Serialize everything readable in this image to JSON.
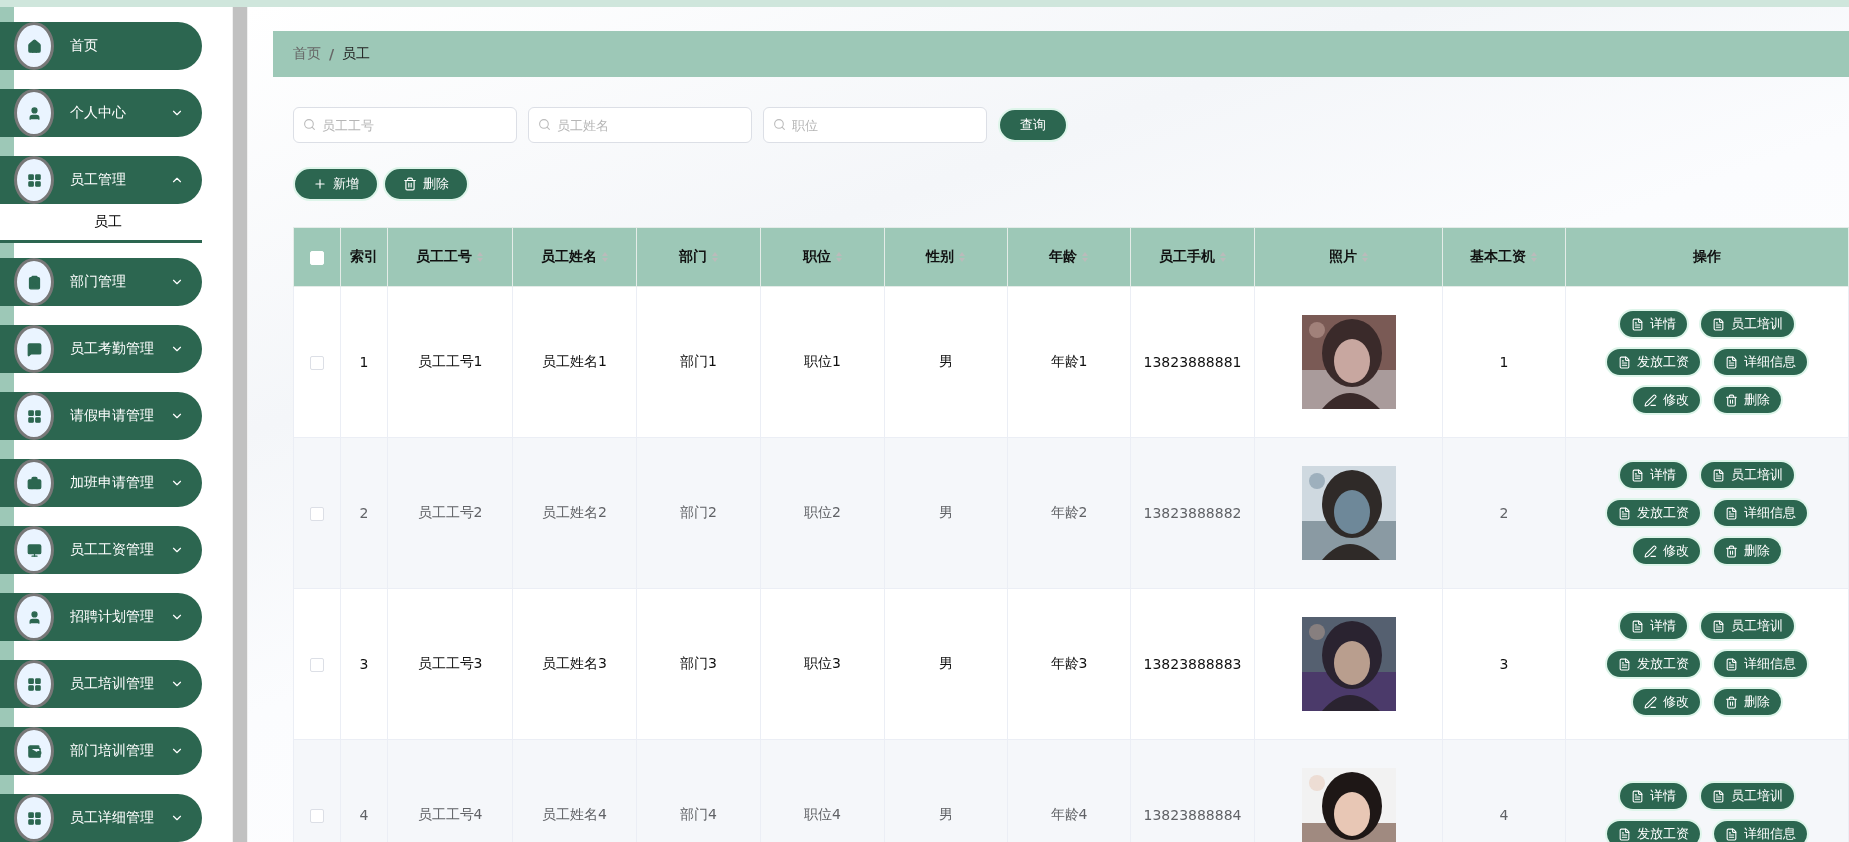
{
  "sidebar": {
    "items": [
      {
        "label": "首页",
        "expandable": false
      },
      {
        "label": "个人中心",
        "expandable": true,
        "expanded": false
      },
      {
        "label": "员工管理",
        "expandable": true,
        "expanded": true,
        "children": [
          {
            "label": "员工",
            "selected": true
          }
        ]
      },
      {
        "label": "部门管理",
        "expandable": true,
        "expanded": false
      },
      {
        "label": "员工考勤管理",
        "expandable": true,
        "expanded": false
      },
      {
        "label": "请假申请管理",
        "expandable": true,
        "expanded": false
      },
      {
        "label": "加班申请管理",
        "expandable": true,
        "expanded": false
      },
      {
        "label": "员工工资管理",
        "expandable": true,
        "expanded": false
      },
      {
        "label": "招聘计划管理",
        "expandable": true,
        "expanded": false
      },
      {
        "label": "员工培训管理",
        "expandable": true,
        "expanded": false
      },
      {
        "label": "部门培训管理",
        "expandable": true,
        "expanded": false
      },
      {
        "label": "员工详细管理",
        "expandable": true,
        "expanded": false
      }
    ]
  },
  "breadcrumb": [
    "首页",
    "/",
    "员工"
  ],
  "search": {
    "fields": [
      {
        "placeholder": "员工工号"
      },
      {
        "placeholder": "员工姓名"
      },
      {
        "placeholder": "职位"
      }
    ],
    "button": "查询"
  },
  "toolbar": [
    {
      "label": "新增",
      "kind": "add"
    },
    {
      "label": "删除",
      "kind": "delete"
    }
  ],
  "table": {
    "select_all": {
      "checked": false
    },
    "columns": [
      {
        "label": "索引",
        "sortable": false
      },
      {
        "label": "员工工号",
        "sortable": true
      },
      {
        "label": "员工姓名",
        "sortable": true
      },
      {
        "label": "部门",
        "sortable": true
      },
      {
        "label": "职位",
        "sortable": true
      },
      {
        "label": "性别",
        "sortable": true
      },
      {
        "label": "年龄",
        "sortable": true
      },
      {
        "label": "员工手机",
        "sortable": true
      },
      {
        "label": "照片",
        "sortable": true
      },
      {
        "label": "基本工资",
        "sortable": true
      },
      {
        "label": "操作",
        "sortable": false
      }
    ],
    "rows": [
      {
        "checked": false,
        "cells": [
          "1",
          "员工工号1",
          "员工姓名1",
          "部门1",
          "职位1",
          "男",
          "年龄1",
          "13823888881"
        ],
        "salary": "1",
        "actions": [
          {
            "label": "详情",
            "kind": "doc"
          },
          {
            "label": "员工培训",
            "kind": "doc"
          },
          {
            "label": "发放工资",
            "kind": "doc"
          },
          {
            "label": "详细信息",
            "kind": "doc"
          },
          {
            "label": "修改",
            "kind": "edit"
          },
          {
            "label": "删除",
            "kind": "delete"
          }
        ]
      },
      {
        "checked": false,
        "cells": [
          "2",
          "员工工号2",
          "员工姓名2",
          "部门2",
          "职位2",
          "男",
          "年龄2",
          "13823888882"
        ],
        "salary": "2",
        "actions": [
          {
            "label": "详情",
            "kind": "doc"
          },
          {
            "label": "员工培训",
            "kind": "doc"
          },
          {
            "label": "发放工资",
            "kind": "doc"
          },
          {
            "label": "详细信息",
            "kind": "doc"
          },
          {
            "label": "修改",
            "kind": "edit"
          },
          {
            "label": "删除",
            "kind": "delete"
          }
        ]
      },
      {
        "checked": false,
        "cells": [
          "3",
          "员工工号3",
          "员工姓名3",
          "部门3",
          "职位3",
          "男",
          "年龄3",
          "13823888883"
        ],
        "salary": "3",
        "actions": [
          {
            "label": "详情",
            "kind": "doc"
          },
          {
            "label": "员工培训",
            "kind": "doc"
          },
          {
            "label": "发放工资",
            "kind": "doc"
          },
          {
            "label": "详细信息",
            "kind": "doc"
          },
          {
            "label": "修改",
            "kind": "edit"
          },
          {
            "label": "删除",
            "kind": "delete"
          }
        ]
      },
      {
        "checked": false,
        "cells": [
          "4",
          "员工工号4",
          "员工姓名4",
          "部门4",
          "职位4",
          "男",
          "年龄4",
          "13823888884"
        ],
        "salary": "4",
        "actions": [
          {
            "label": "详情",
            "kind": "doc"
          },
          {
            "label": "员工培训",
            "kind": "doc"
          },
          {
            "label": "发放工资",
            "kind": "doc"
          },
          {
            "label": "详细信息",
            "kind": "doc"
          }
        ]
      }
    ]
  }
}
